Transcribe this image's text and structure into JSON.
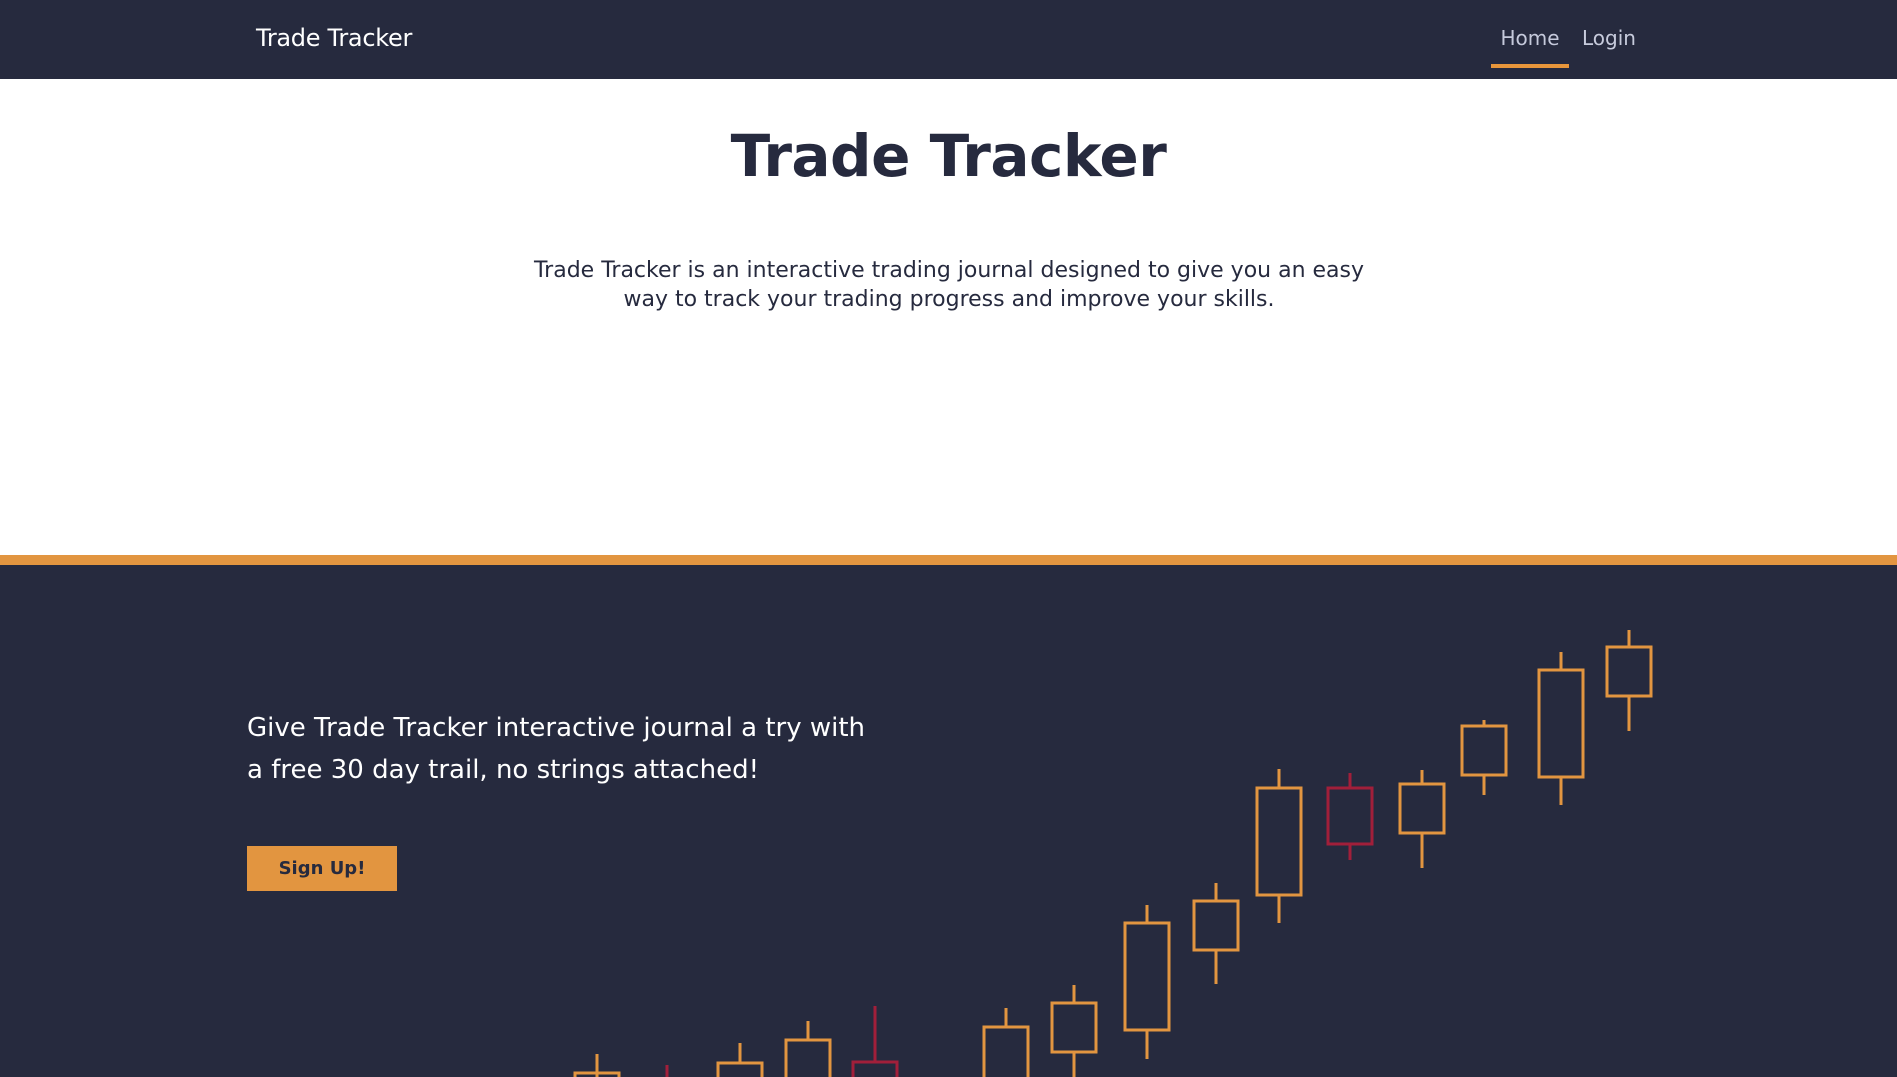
{
  "navbar": {
    "brand": "Trade Tracker",
    "links": [
      {
        "label": "Home",
        "active": true
      },
      {
        "label": "Login",
        "active": false
      }
    ]
  },
  "hero": {
    "title": "Trade Tracker",
    "description": "Trade Tracker is an interactive trading journal designed to give you an easy way to track your trading progress and improve your skills."
  },
  "cta": {
    "text": "Give Trade Tracker interactive journal a try with a free 30 day trail, no strings attached!",
    "button_label": "Sign Up!"
  },
  "colors": {
    "navy": "#262a3e",
    "accent": "#e29540",
    "bearish": "#a11f3a"
  }
}
